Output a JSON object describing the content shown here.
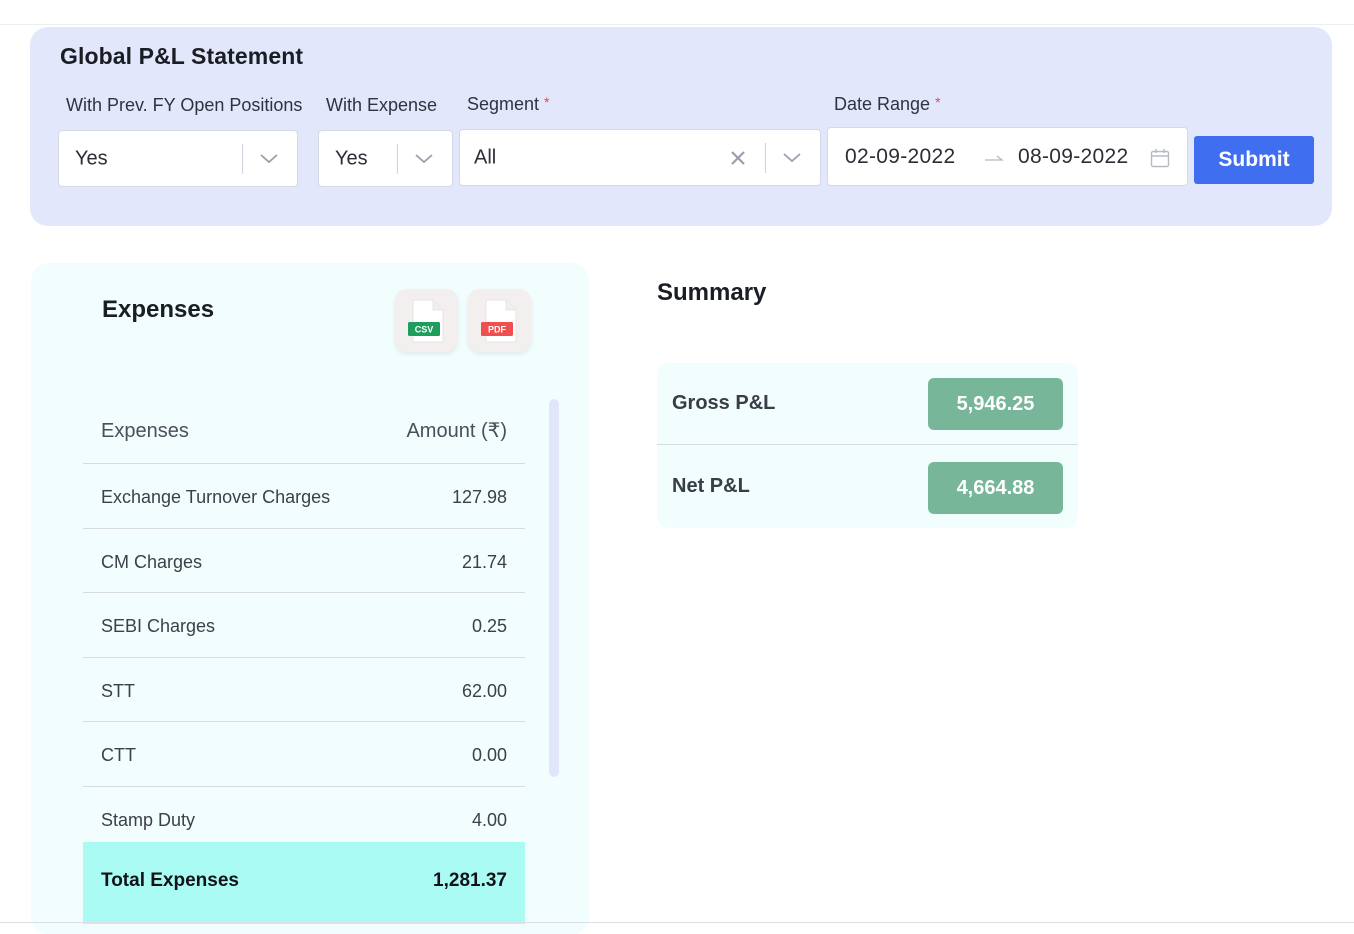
{
  "filters": {
    "title": "Global P&L Statement",
    "prev_fy": {
      "label": "With Prev. FY Open Positions",
      "value": "Yes"
    },
    "with_expense": {
      "label": "With Expense",
      "value": "Yes"
    },
    "segment": {
      "label": "Segment",
      "required_mark": "*",
      "value": "All"
    },
    "date_range": {
      "label": "Date Range",
      "required_mark": "*",
      "start": "02-09-2022",
      "end": "08-09-2022"
    },
    "submit_label": "Submit"
  },
  "expenses": {
    "title": "Expenses",
    "csv_label": "CSV",
    "pdf_label": "PDF",
    "columns": [
      "Expenses",
      "Amount (₹)"
    ],
    "rows": [
      {
        "name": "Exchange Turnover Charges",
        "amount": "127.98"
      },
      {
        "name": "CM Charges",
        "amount": "21.74"
      },
      {
        "name": "SEBI Charges",
        "amount": "0.25"
      },
      {
        "name": "STT",
        "amount": "62.00"
      },
      {
        "name": "CTT",
        "amount": "0.00"
      },
      {
        "name": "Stamp Duty",
        "amount": "4.00"
      }
    ],
    "total": {
      "label": "Total Expenses",
      "amount": "1,281.37"
    }
  },
  "summary": {
    "title": "Summary",
    "gross": {
      "label": "Gross P&L",
      "value": "5,946.25"
    },
    "net": {
      "label": "Net P&L",
      "value": "4,664.88"
    }
  },
  "colors": {
    "accent": "#3f6ef0",
    "filter_bg": "#e2e7fc",
    "card_bg": "#f2fdfe",
    "total_bg": "#a9fbf3",
    "pill_green": "#78b69a",
    "csv_green": "#1e9e5c",
    "pdf_red": "#ef4f4f",
    "required_red": "#e24b4b"
  }
}
